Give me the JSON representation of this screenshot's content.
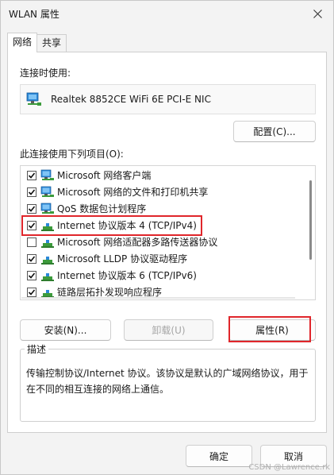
{
  "window": {
    "title": "WLAN 属性"
  },
  "tabs": [
    {
      "label": "网络",
      "active": true
    },
    {
      "label": "共享",
      "active": false
    }
  ],
  "connect_using": {
    "label": "连接时使用:",
    "adapter": "Realtek 8852CE WiFi 6E PCI-E NIC",
    "configure_button": "配置(C)..."
  },
  "items_section": {
    "label": "此连接使用下列项目(O):",
    "items": [
      {
        "label": "Microsoft 网络客户端",
        "checked": true,
        "icon": "network-client-icon"
      },
      {
        "label": "Microsoft 网络的文件和打印机共享",
        "checked": true,
        "icon": "network-client-icon"
      },
      {
        "label": "QoS 数据包计划程序",
        "checked": true,
        "icon": "network-client-icon"
      },
      {
        "label": "Internet 协议版本 4 (TCP/IPv4)",
        "checked": true,
        "icon": "protocol-icon"
      },
      {
        "label": "Microsoft 网络适配器多路传送器协议",
        "checked": false,
        "icon": "protocol-icon"
      },
      {
        "label": "Microsoft LLDP 协议驱动程序",
        "checked": true,
        "icon": "protocol-icon"
      },
      {
        "label": "Internet 协议版本 6 (TCP/IPv6)",
        "checked": true,
        "icon": "protocol-icon"
      },
      {
        "label": "链路层拓扑发现响应程序",
        "checked": true,
        "icon": "protocol-icon"
      }
    ]
  },
  "actions": {
    "install": "安装(N)...",
    "uninstall": "卸载(U)",
    "properties": "属性(R)"
  },
  "description": {
    "title": "描述",
    "text": "传输控制协议/Internet 协议。该协议是默认的广域网络协议，用于在不同的相互连接的网络上通信。"
  },
  "footer": {
    "ok": "确定",
    "cancel": "取消"
  },
  "watermark": "CSDN @Lawrence.rk",
  "colors": {
    "highlight": "#e0262b",
    "accent": "#0067c0"
  }
}
